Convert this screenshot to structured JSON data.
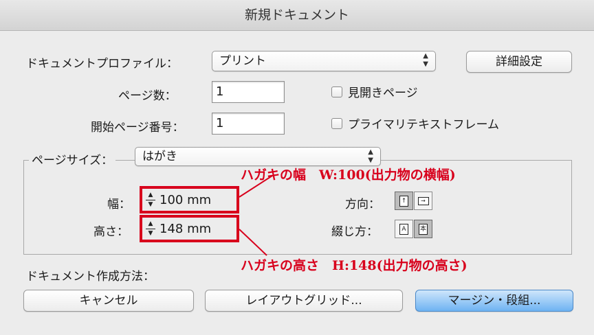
{
  "window": {
    "title": "新規ドキュメント"
  },
  "profile": {
    "label": "ドキュメントプロファイル：",
    "value": "プリント"
  },
  "detail_button": "詳細設定",
  "pages": {
    "label": "ページ数：",
    "value": "1"
  },
  "start_page": {
    "label": "開始ページ番号：",
    "value": "1"
  },
  "facing_pages": "見開きページ",
  "primary_text_frame": "プライマリテキストフレーム",
  "page_size": {
    "label": "ページサイズ：",
    "value": "はがき"
  },
  "width": {
    "label": "幅：",
    "value": "100 mm"
  },
  "height": {
    "label": "高さ：",
    "value": "148 mm"
  },
  "orientation": {
    "label": "方向：",
    "portrait_glyph": "↑",
    "landscape_glyph": "→"
  },
  "binding": {
    "label": "綴じ方：",
    "left_glyph": "A",
    "right_glyph": "本"
  },
  "create_method": {
    "label": "ドキュメント作成方法："
  },
  "buttons": {
    "cancel": "キャンセル",
    "layout_grid": "レイアウトグリッド...",
    "margins_columns": "マージン・段組..."
  },
  "annotations": {
    "width_note": "ハガキの幅　W:100(出力物の横幅)",
    "height_note": "ハガキの高さ　H:148(出力物の高さ)",
    "color": "#d8001c"
  },
  "colors": {
    "accent_button": "#6eb3f2",
    "annotation": "#d8001c"
  }
}
